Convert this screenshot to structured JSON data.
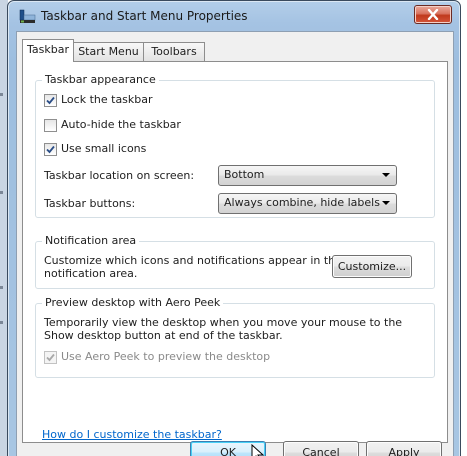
{
  "window": {
    "title": "Taskbar and Start Menu Properties"
  },
  "tabs": [
    {
      "label": "Taskbar",
      "active": true
    },
    {
      "label": "Start Menu",
      "active": false
    },
    {
      "label": "Toolbars",
      "active": false
    }
  ],
  "taskbar_appearance": {
    "heading": "Taskbar appearance",
    "lock_taskbar": {
      "label": "Lock the taskbar",
      "checked": true
    },
    "auto_hide": {
      "label": "Auto-hide the taskbar",
      "checked": false
    },
    "small_icons": {
      "label": "Use small icons",
      "checked": true
    },
    "location": {
      "label": "Taskbar location on screen:",
      "value": "Bottom"
    },
    "buttons": {
      "label": "Taskbar buttons:",
      "value": "Always combine, hide labels"
    }
  },
  "notification_area": {
    "heading": "Notification area",
    "description_line1": "Customize which icons and notifications appear in the",
    "description_line2": "notification area.",
    "customize_label": "Customize..."
  },
  "aero_peek": {
    "heading": "Preview desktop with Aero Peek",
    "description_line1": "Temporarily view the desktop when you move your mouse to the",
    "description_line2": "Show desktop button at end of the taskbar.",
    "use_aero_peek": {
      "label": "Use Aero Peek to preview the desktop",
      "checked": true,
      "disabled": true
    }
  },
  "help_link": "How do I customize the taskbar?",
  "footer": {
    "ok_label": "OK",
    "cancel_label": "Cancel",
    "apply_label": "Apply"
  },
  "colors": {
    "accent": "#0066cc",
    "close_button": "#c0391d",
    "window_frame": "#a5c3e3"
  },
  "icons": {
    "title_icon": "taskbar-icon",
    "close_icon": "close-icon",
    "check_icon": "checkmark-icon",
    "cursor_icon": "mouse-pointer-icon"
  }
}
